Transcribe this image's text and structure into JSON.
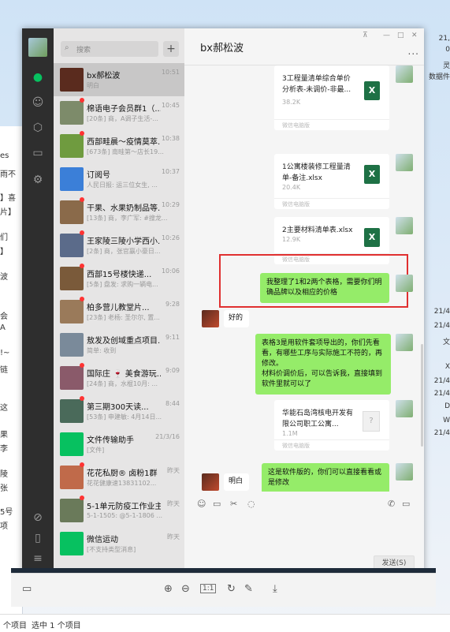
{
  "background": {
    "left_texts": [
      "es",
      "雨不",
      "】喜",
      "片】",
      "们",
      "】",
      "波",
      "会",
      "A",
      "!~",
      "链",
      "这",
      "果",
      "李",
      "陵",
      "张",
      "5号",
      "项"
    ],
    "right_texts": [
      "21,",
      "0",
      "灵",
      "数据件",
      "21/4",
      "21/4",
      "文",
      "X",
      "21/4",
      "21/4",
      "D",
      "W",
      "21/4"
    ],
    "statusbar": {
      "items": "个项目",
      "selected": "选中 1 个项目"
    }
  },
  "sidebar_rail": {
    "icons": [
      "avatar-icon",
      "chat-icon",
      "contacts-icon",
      "favorites-icon",
      "files-icon",
      "settings-icon",
      "miniprogram-icon",
      "phone-icon",
      "menu-icon"
    ]
  },
  "search": {
    "placeholder": "搜索",
    "add": "+"
  },
  "conversations": [
    {
      "name": "bx郝松波",
      "time": "10:51",
      "preview": "明白",
      "selected": true,
      "dot": false,
      "color": "#5a2b1e"
    },
    {
      "name": "棉语电子会员群1（...",
      "time": "10:45",
      "preview": "[20条] 商，A调子生活-...",
      "dot": true,
      "color": "#7d8b6a"
    },
    {
      "name": "西部畦晨～疫情莫萃...",
      "time": "10:38",
      "preview": "[673条] 南畦第～店长19...",
      "dot": true,
      "color": "#6f9b3f"
    },
    {
      "name": "订阅号",
      "time": "10:37",
      "preview": "人民日报: 运三位女生, ...",
      "dot": false,
      "color": "#3b7fd8"
    },
    {
      "name": "干果、水果奶制品等...",
      "time": "10:29",
      "preview": "[13条] 商，李广军: #搜龙...",
      "dot": true,
      "color": "#8a6a4a"
    },
    {
      "name": "王家陵三陵小学西小...",
      "time": "10:26",
      "preview": "[2条] 商，张官赢小豪日...",
      "dot": true,
      "color": "#5b6b8a"
    },
    {
      "name": "西部15号楼快递...",
      "time": "10:06",
      "preview": "[5条] 盘发: 求购一辆电...",
      "dot": true,
      "color": "#7a5a3a"
    },
    {
      "name": "柏多营儿教堂片...",
      "time": "9:28",
      "preview": "[23条] 老杨: 圣尔尔, 置...",
      "dot": true,
      "color": "#9a7a5a"
    },
    {
      "name": "敖发及创域重点项目...",
      "time": "9:11",
      "preview": "简单: 收到",
      "dot": false,
      "color": "#7a8a9a"
    },
    {
      "name": "国际庄 🍷 美食游玩...",
      "time": "9:09",
      "preview": "[24条] 商，水棍10月: ...",
      "dot": true,
      "color": "#8a5a6a"
    },
    {
      "name": "第三期300天读...",
      "time": "8:44",
      "preview": "[53条] 申建敏: 4月14日...",
      "dot": true,
      "color": "#4a6a5a"
    },
    {
      "name": "文件传输助手",
      "time": "21/3/16",
      "preview": "[文件]",
      "dot": false,
      "color": "#07c160"
    },
    {
      "name": "花花私厨® 卤粉1群",
      "time": "昨天",
      "preview": "花花健康速13831102...",
      "dot": true,
      "color": "#c06a4a"
    },
    {
      "name": "5-1单元防疫工作业主群",
      "time": "昨天",
      "preview": "5-1-1505: @5-1-1806 ...",
      "dot": true,
      "color": "#6a7a5a"
    },
    {
      "name": "微信运动",
      "time": "昨天",
      "preview": "[不支持类型消息]",
      "dot": false,
      "color": "#07c160"
    }
  ],
  "chat": {
    "title": "bx郝松波",
    "more": "...",
    "files": [
      {
        "name": "3工程量清单综合单价分析表-未调价-非最...",
        "size": "38.2K",
        "source": "微信电脑版",
        "type": "xls"
      },
      {
        "name": "1公寓楼装修工程量清单-备注.xlsx",
        "size": "20.4K",
        "source": "微信电脑版",
        "type": "xls"
      },
      {
        "name": "2主要材料清单表.xlsx",
        "size": "12.9K",
        "source": "微信电脑版",
        "type": "xls"
      },
      {
        "name": "华能石岛湾核电开发有限公司职工公寓...",
        "size": "1.1M",
        "source": "微信电脑版",
        "type": "doc"
      }
    ],
    "messages": {
      "m1": "我整理了1和2两个表格，需要你们明确品牌以及相应的价格",
      "r1": "好的",
      "m2": "表格3是用软件套项导出的，你们先看看，有哪些工序与实际施工不符的，再修改。\n材料价调价后，可以告诉我，直接填到软件里就可以了",
      "m3": "这是软件版的，你们可以直接看看或是修改",
      "r2": "明白"
    },
    "toolbar_icons": [
      "emoji-icon",
      "folder-icon",
      "scissors-icon",
      "chat-bubble-icon",
      "phone-icon",
      "video-icon"
    ],
    "send_label": "发送(S)"
  },
  "viewer": {
    "page_box": "1:1"
  }
}
